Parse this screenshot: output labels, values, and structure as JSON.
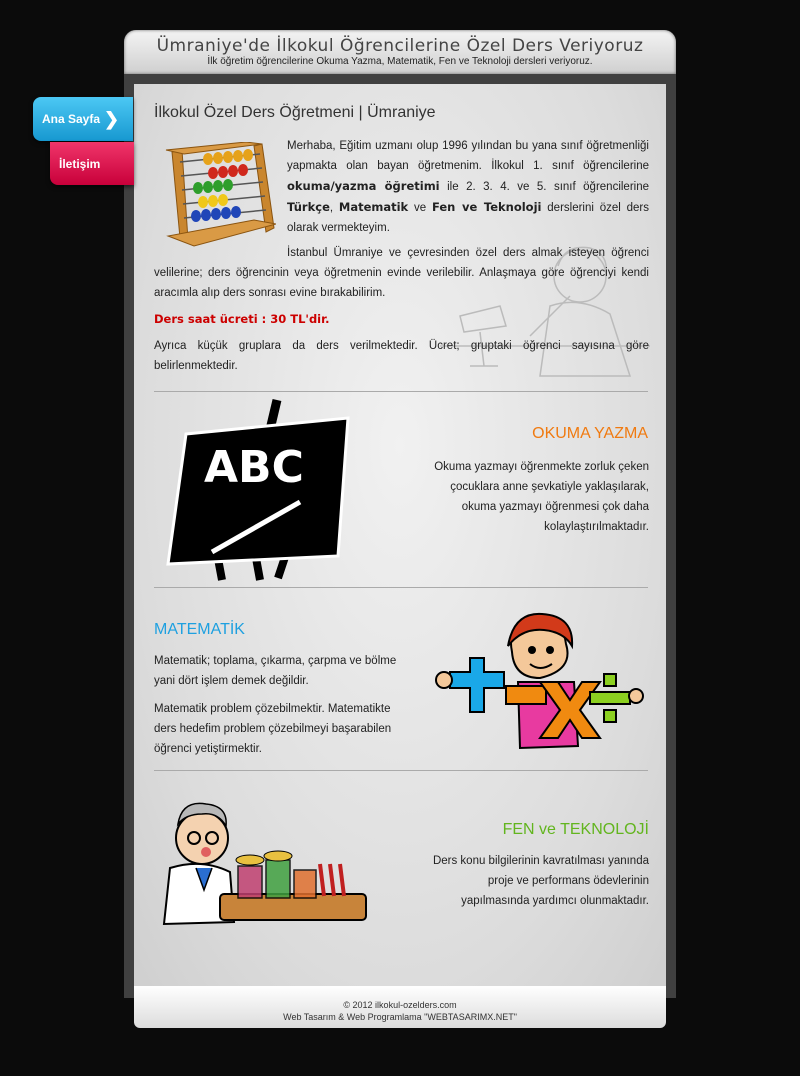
{
  "header": {
    "title": "Ümraniye'de İlkokul Öğrencilerine Özel Ders Veriyoruz",
    "subtitle": "İlk öğretim öğrencilerine Okuma Yazma, Matematik, Fen ve Teknoloji dersleri veriyoruz."
  },
  "nav": {
    "home_label": "Ana Sayfa",
    "contact_label": "İletişim"
  },
  "intro": {
    "heading": "İlkokul Özel Ders Öğretmeni | Ümraniye",
    "p1_a": "Merhaba, Eğitim uzmanı olup 1996 yılından bu yana sınıf öğretmenliği yapmakta olan bayan öğretmenim. İlkokul 1. sınıf öğrencilerine ",
    "p1_b": "okuma/yazma öğretimi",
    "p1_c": " ile 2. 3. 4. ve 5. sınıf öğrencilerine ",
    "p1_d": "Türkçe",
    "p1_e": ", ",
    "p1_f": "Matematik",
    "p1_g": " ve ",
    "p1_h": "Fen ve Teknoloji",
    "p1_i": " derslerini özel ders olarak vermekteyim.",
    "p2": "İstanbul Ümraniye ve çevresinden özel ders almak isteyen öğrenci velilerine; ders öğrencinin veya öğretmenin evinde verilebilir. Anlaşmaya göre öğrenciyi kendi aracımla alıp ders sonrası evine bırakabilirim.",
    "price": "Ders saat ücreti : 30 TL'dir.",
    "p3": "Ayrıca küçük gruplara da ders verilmektedir. Ücret; gruptaki öğrenci sayısına göre belirlenmektedir."
  },
  "okuma": {
    "title": "OKUMA YAZMA",
    "text": "Okuma yazmayı öğrenmekte zorluk çeken çocuklara anne şevkatiyle yaklaşılarak, okuma yazmayı öğrenmesi çok daha kolaylaştırılmaktadır.",
    "board_text": "ABC",
    "color": "#f07a10"
  },
  "matematik": {
    "title": "MATEMATİK",
    "p1": "Matematik; toplama, çıkarma, çarpma ve bölme yani dört işlem demek değildir.",
    "p2": "Matematik problem çözebilmektir. Matematikte ders hedefim problem çözebilmeyi başarabilen öğrenci yetiştirmektir.",
    "color": "#1ea0e0"
  },
  "fen": {
    "title": "FEN ve TEKNOLOJİ",
    "text": "Ders konu bilgilerinin kavratılması yanında proje ve performans ödevlerinin yapılmasında yardımcı olunmaktadır.",
    "color": "#62b51e"
  },
  "footer": {
    "copyright": "© 2012 ilkokul-ozelders.com",
    "credit": "Web Tasarım & Web Programlama \"WEBTASARIMX.NET\""
  },
  "colors": {
    "price": "#cc0000",
    "nav_home": "#29aee3",
    "nav_contact": "#e3124f"
  }
}
